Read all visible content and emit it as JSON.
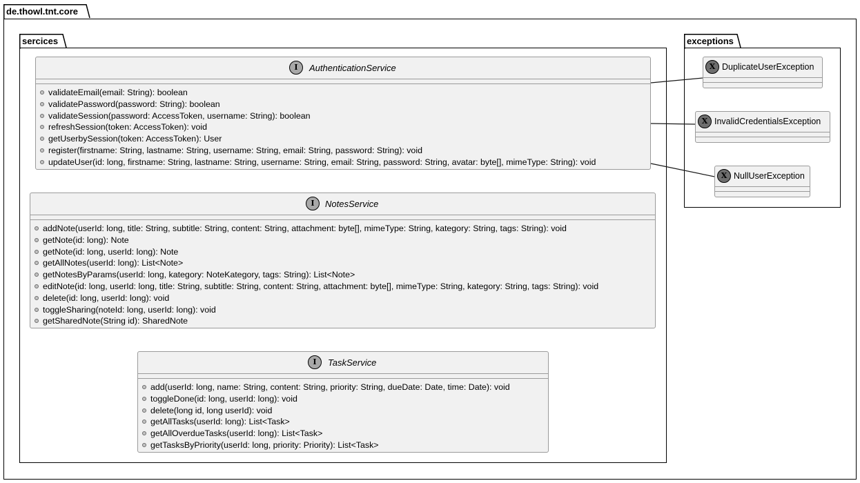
{
  "packages": {
    "root": "de.thowl.tnt.core",
    "services": "sercices",
    "exceptions": "exceptions"
  },
  "classes": {
    "auth": {
      "stereotype": "I",
      "name": "AuthenticationService",
      "methods": [
        "validateEmail(email: String): boolean",
        "validatePassword(password: String): boolean",
        "validateSession(password: AccessToken, username: String): boolean",
        "refreshSession(token: AccessToken): void",
        "getUserbySession(token: AccessToken): User",
        "register(firstname: String, lastname: String, username: String, email: String, password: String): void",
        "updateUser(id: long, firstname: String, lastname: String, username: String, email: String, password: String, avatar: byte[], mimeType: String): void"
      ]
    },
    "notes": {
      "stereotype": "I",
      "name": "NotesService",
      "methods": [
        "addNote(userId: long, title: String, subtitle: String, content: String, attachment: byte[], mimeType: String, kategory: String, tags: String): void",
        "getNote(id: long): Note",
        "getNote(id: long, userId: long): Note",
        "getAllNotes(userId: long): List<Note>",
        "getNotesByParams(userId: long, kategory: NoteKategory, tags: String): List<Note>",
        "editNote(id: long, userId: long, title: String, subtitle: String, content: String, attachment: byte[], mimeType: String, kategory: String, tags: String): void",
        "delete(id: long, userId: long): void",
        "toggleSharing(noteId: long, userId: long): void",
        "getSharedNote(String id): SharedNote"
      ]
    },
    "task": {
      "stereotype": "I",
      "name": "TaskService",
      "methods": [
        "add(userId: long, name: String, content: String, priority: String, dueDate: Date, time: Date): void",
        "toggleDone(id: long, userId: long): void",
        "delete(long id, long userId): void",
        "getAllTasks(userId: long): List<Task>",
        "getAllOverdueTasks(userId: long): List<Task>",
        "getTasksByPriority(userId: long, priority: Priority): List<Task>"
      ]
    },
    "dup": {
      "stereotype": "X",
      "name": "DuplicateUserException"
    },
    "inv": {
      "stereotype": "X",
      "name": "InvalidCredentialsException"
    },
    "nul": {
      "stereotype": "X",
      "name": "NullUserException"
    }
  },
  "colors": {
    "class_fill": "#f1f1f1",
    "class_border": "#9a9a9a",
    "interface_badge": "#a8a8a8",
    "exception_badge": "#6e6e6e"
  }
}
